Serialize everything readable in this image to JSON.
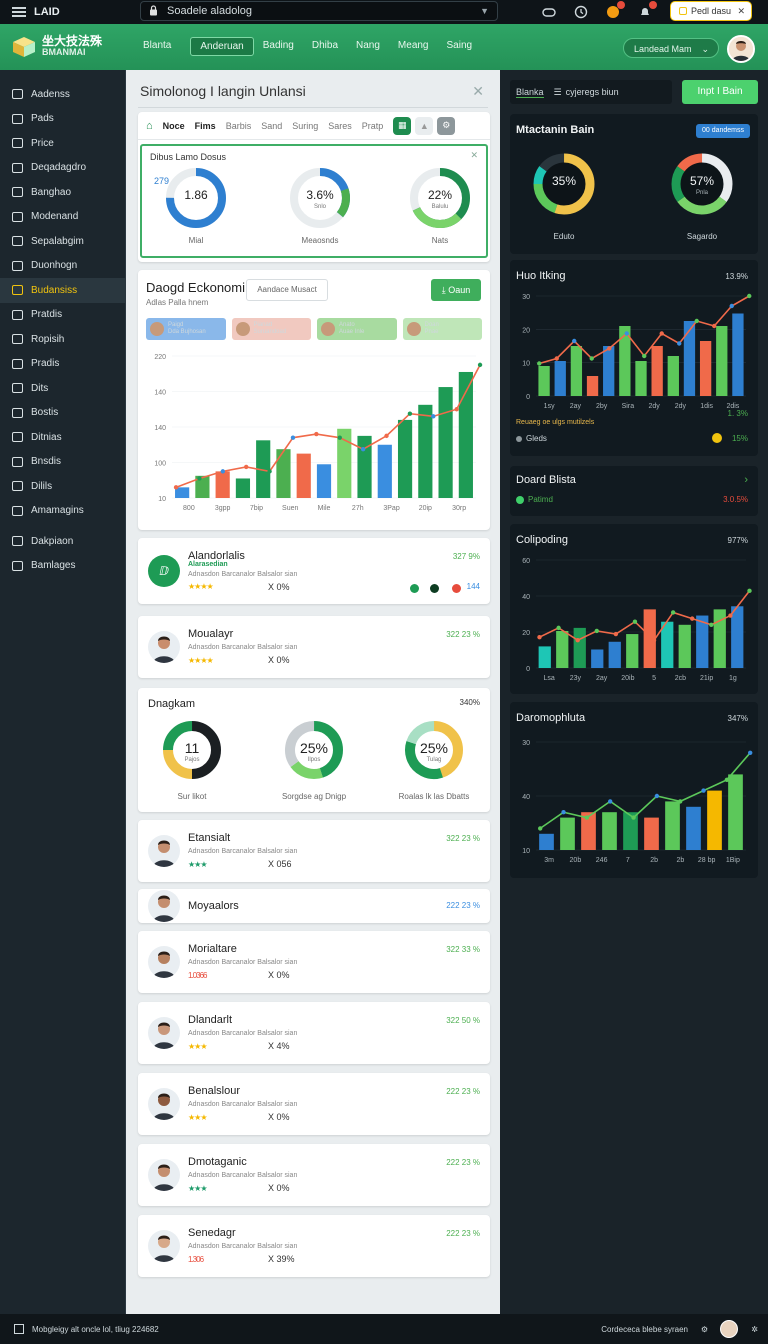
{
  "topbar": {
    "brand": "LAID",
    "url": "Soadele aladolog",
    "button_label": "Pedl dasu"
  },
  "header": {
    "logo_line1": "坐大技法殊",
    "logo_line2": "BMANMAI",
    "tabs": [
      "Blanta",
      "Anderuan",
      "Bading",
      "Dhiba",
      "Nang",
      "Meang",
      "Saing"
    ],
    "user_select": "Landead Mam"
  },
  "sidebar": {
    "items": [
      {
        "label": "Aadenss",
        "icon": "home-icon"
      },
      {
        "label": "Pads",
        "icon": "house-icon"
      },
      {
        "label": "Price",
        "icon": "tag-icon"
      },
      {
        "label": "Deqadagdro",
        "icon": "document-icon"
      },
      {
        "label": "Banghao",
        "icon": "building-icon"
      },
      {
        "label": "Modenand",
        "icon": "monitor-icon"
      },
      {
        "label": "Sepalabgim",
        "icon": "screen-icon"
      },
      {
        "label": "Duonhogn",
        "icon": "calendar-icon"
      },
      {
        "label": "Budansiss",
        "icon": "folder-icon"
      },
      {
        "label": "Pratdis",
        "icon": "circle-icon"
      },
      {
        "label": "Ropisih",
        "icon": "list-icon"
      },
      {
        "label": "Pradis",
        "icon": "search-icon"
      },
      {
        "label": "Dits",
        "icon": "grid-icon"
      },
      {
        "label": "Bostis",
        "icon": "image-icon"
      },
      {
        "label": "Ditnias",
        "icon": "gear-icon"
      },
      {
        "label": "Bnsdis",
        "icon": "photo-icon"
      },
      {
        "label": "Dilils",
        "icon": "info-icon"
      },
      {
        "label": "Amamagins",
        "icon": "globe-icon"
      },
      {
        "label": "Dakpiaon",
        "icon": "apps-icon"
      },
      {
        "label": "Bamlages",
        "icon": "dashboard-icon"
      }
    ],
    "active_index": 8
  },
  "main": {
    "title": "Simolonog I langin Unlansi",
    "subtabs": [
      "Noce",
      "Fims",
      "Barbis",
      "Sand",
      "Suring",
      "Sares",
      "Pratp"
    ],
    "gauge_card": {
      "title": "Dibus Lamo Dosus",
      "side_value": "279",
      "gauges": [
        {
          "value": "1.86",
          "sub": "",
          "label": "Mial",
          "pct": 0.75,
          "color": "#2e7fd0"
        },
        {
          "value": "3.6%",
          "sub": "Snlo",
          "label": "Meaosnds",
          "pct": 0.36,
          "color": "#2e7fd0",
          "color2": "#4caf50"
        },
        {
          "value": "22%",
          "sub": "Balulu",
          "label": "Nats",
          "pct": 0.68,
          "color": "#1e8c4f",
          "color2": "#7ad36a"
        }
      ]
    },
    "chart_card": {
      "title": "Daogd Eckonomi",
      "subtitle": "Adlas Palla hnem",
      "input": "Aandace Musact",
      "button": "Oaun",
      "chips": [
        {
          "line1": "Paigd",
          "line2": "Dda Bujhosan",
          "bg": "#8ab8ea"
        },
        {
          "line1": "Pianad",
          "line2": "Suruandoad",
          "bg": "#f1c9c0"
        },
        {
          "line1": "Anato",
          "line2": "Auae Inle",
          "bg": "#a8dba0"
        },
        {
          "line1": "Doan",
          "line2": "Pnae",
          "bg": "#bfe6b8"
        }
      ]
    },
    "people": [
      {
        "name": "Alandorlalis",
        "subname": "Alarasedian",
        "desc": "Adnasdon Barcanalor Balsalor sian",
        "value": "X 0%",
        "amount": "327 9%",
        "stars": "★★★★",
        "star_color": "#f5b800"
      },
      {
        "name": "Moualayr",
        "subname": "",
        "desc": "Adnasdon Barcanalor Balsalor sian",
        "value": "X 0%",
        "amount": "322 23 %",
        "stars": "★★★★",
        "star_color": "#f5b800"
      },
      {
        "name": "Etansialt",
        "subname": "",
        "desc": "Adnasdon Barcanalor Balsalor sian",
        "value": "X 056",
        "amount": "322 23 %",
        "stars": "★★★",
        "star_color": "#1e9b6a"
      },
      {
        "name": "Moyaalors",
        "subname": "",
        "desc": "",
        "value": "",
        "amount": "222 23 %",
        "stars": "",
        "star_color": "#f5b800"
      },
      {
        "name": "Morialtare",
        "subname": "",
        "desc": "Adnasdon Barcanalor Balsalor sian",
        "value": "X 0%",
        "amount": "322 33 %",
        "stars": "1.0366",
        "star_color": "#e74c3c"
      },
      {
        "name": "Dlandarlt",
        "subname": "",
        "desc": "Adnasdon Barcanalor Balsalor sian",
        "value": "X 4%",
        "amount": "322 50 %",
        "stars": "★★★",
        "star_color": "#f5b800"
      },
      {
        "name": "Benalslour",
        "subname": "",
        "desc": "Adnasdon Barcanalor Balsalor sian",
        "value": "X 0%",
        "amount": "222 23 %",
        "stars": "★★★",
        "star_color": "#f5b800"
      },
      {
        "name": "Dmotaganic",
        "subname": "",
        "desc": "Adnasdon Barcanalor Balsalor sian",
        "value": "X 0%",
        "amount": "222 23 %",
        "stars": "★★★",
        "star_color": "#1e9b6a"
      },
      {
        "name": "Senedagr",
        "subname": "",
        "desc": "Adnasdon Barcanalor Balsalor sian",
        "value": "X 39%",
        "amount": "222 23 %",
        "stars": "1.306",
        "star_color": "#e74c3c"
      }
    ],
    "first_person_dots": "144",
    "donut_card": {
      "title": "Dnagkam",
      "right": "340%",
      "donuts": [
        {
          "value": "11",
          "sub": "Pajos",
          "label": "Sur likot"
        },
        {
          "value": "25%",
          "sub": "Ilpos",
          "label": "Sorgdse ag Dnigp"
        },
        {
          "value": "25%",
          "sub": "Tulag",
          "label": "Roalas lk las Dbatts"
        }
      ]
    }
  },
  "right": {
    "tabs": [
      "Blanka",
      "cyjeregs biun"
    ],
    "button": "Inpt I Bain",
    "gauges_card": {
      "title": "Mtactanin Bain",
      "badge": "00 dandemss",
      "gauges": [
        {
          "value": "35%",
          "label": "Eduto"
        },
        {
          "value": "57%",
          "sub": "Pnla",
          "label": "Sagardo"
        }
      ]
    },
    "trend_card": {
      "title": "Huo Itking",
      "right": "13.9%",
      "legend": [
        {
          "text": "Reuaeg oe ulgs mutilzels",
          "value": "1. 3%"
        },
        {
          "text": "Gleds",
          "value": "15%"
        }
      ]
    },
    "board_card": {
      "title": "Doard Blista",
      "item": "Patimd",
      "value": "3.0.5%"
    },
    "chart2": {
      "title": "Colipoding",
      "right": "977%"
    },
    "chart3": {
      "title": "Daromophluta",
      "right": "347%"
    }
  },
  "footer": {
    "left": "Mobgleigy alt oncle lol, tliug 224682",
    "right": "Cordececa blebe syraen"
  },
  "chart_data": [
    {
      "type": "bar",
      "title": "Daogd Eckonomi",
      "categories": [
        "800",
        "3gpp",
        "7bip",
        "Suen",
        "Mile",
        "27h",
        "3Pap",
        "20ip",
        "30rp"
      ],
      "yticks": [
        10,
        100,
        140,
        140,
        220
      ],
      "series": [
        {
          "name": "Paigd",
          "color": "#3a8ee0",
          "values": [
            10,
            22,
            24,
            18,
            32,
            35,
            40,
            52,
            78
          ]
        },
        {
          "name": "Pianad",
          "color": "#f06a4a",
          "values": [
            25,
            30,
            58,
            45,
            40,
            38,
            40,
            55,
            62
          ]
        },
        {
          "name": "Anato",
          "color": "#1e9b55",
          "values": [
            28,
            0,
            70,
            0,
            52,
            0,
            80,
            95,
            125
          ]
        }
      ],
      "bars": [
        12,
        25,
        30,
        22,
        65,
        55,
        50,
        38,
        78,
        70,
        60,
        88,
        105,
        125,
        142
      ],
      "bar_colors": [
        "#3a8ee0",
        "#4caf50",
        "#f06a4a",
        "#1e9b55",
        "#1e9b55",
        "#4caf50",
        "#f06a4a",
        "#3a8ee0",
        "#7ad36a",
        "#1e9b55",
        "#3a8ee0",
        "#1e9b55",
        "#1e9b55",
        "#1e9b55",
        "#1e9b55"
      ],
      "line": [
        12,
        22,
        30,
        35,
        30,
        68,
        72,
        68,
        55,
        70,
        95,
        92,
        100,
        150
      ],
      "ylim": [
        0,
        160
      ]
    },
    {
      "type": "bar",
      "title": "Huo Itking",
      "categories": [
        "1sy",
        "2ay",
        "2by",
        "Sira",
        "2dy",
        "2dy",
        "1dis",
        "2dis"
      ],
      "yticks": [
        0,
        10,
        20,
        30
      ],
      "bars": [
        12,
        14,
        20,
        8,
        20,
        28,
        14,
        20,
        16,
        30,
        22,
        28,
        33
      ],
      "bar_colors": [
        "#5cc85a",
        "#2e7fd0",
        "#5cc85a",
        "#f06a4a",
        "#2e7fd0",
        "#5cc85a",
        "#5cc85a",
        "#f06a4a",
        "#5cc85a",
        "#2e7fd0",
        "#f06a4a",
        "#5cc85a",
        "#2e7fd0"
      ],
      "line": [
        13,
        15,
        22,
        15,
        19,
        25,
        16,
        25,
        21,
        30,
        28,
        36,
        40
      ],
      "ylim": [
        0,
        40
      ]
    },
    {
      "type": "bar",
      "title": "Colipoding",
      "categories": [
        "Lsa",
        "23y",
        "2ay",
        "20ib",
        "5",
        "2cb",
        "21ip",
        "1g"
      ],
      "yticks": [
        0,
        20,
        40,
        60
      ],
      "bars": [
        14,
        24,
        26,
        12,
        17,
        22,
        38,
        30,
        28,
        34,
        38,
        40
      ],
      "bar_colors": [
        "#1ec6b5",
        "#5cc85a",
        "#1e9b55",
        "#2e7fd0",
        "#2e7fd0",
        "#5cc85a",
        "#f06a4a",
        "#1ec6b5",
        "#5cc85a",
        "#2e7fd0",
        "#5cc85a",
        "#2e7fd0"
      ],
      "line": [
        20,
        26,
        18,
        24,
        22,
        30,
        18,
        36,
        32,
        28,
        34,
        50
      ],
      "ylim": [
        0,
        70
      ]
    },
    {
      "type": "bar",
      "title": "Daromophluta",
      "categories": [
        "3m",
        "20b",
        "246",
        "7",
        "2b",
        "2b",
        "28 bp",
        "1Bip"
      ],
      "yticks": [
        10,
        40,
        30
      ],
      "bars": [
        6,
        12,
        14,
        14,
        14,
        12,
        18,
        16,
        22,
        28
      ],
      "bar_colors": [
        "#2e7fd0",
        "#5cc85a",
        "#f06a4a",
        "#5cc85a",
        "#1e9b55",
        "#f06a4a",
        "#5cc85a",
        "#2e7fd0",
        "#f5b800",
        "#5cc85a"
      ],
      "line": [
        8,
        14,
        12,
        18,
        12,
        20,
        18,
        22,
        26,
        36
      ],
      "ylim": [
        0,
        40
      ]
    }
  ]
}
